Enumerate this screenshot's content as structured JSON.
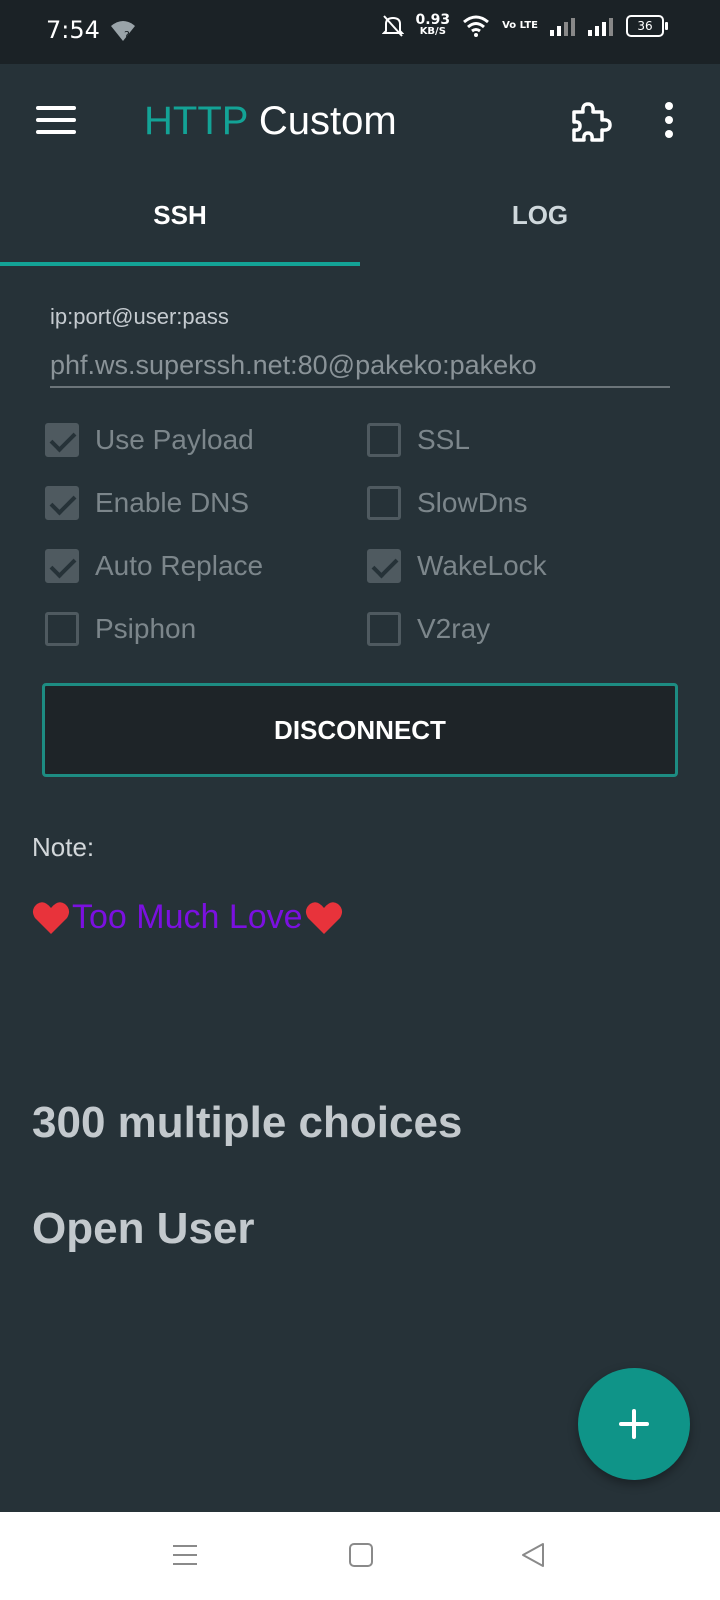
{
  "status_bar": {
    "time": "7:54",
    "speed_value": "0.93",
    "speed_unit": "KB/S",
    "volte": "Vo LTE",
    "battery": "36"
  },
  "app": {
    "title_accent": "HTTP",
    "title_rest": " Custom",
    "accent_color": "#13a396",
    "tabs": [
      {
        "label": "SSH",
        "active": true
      },
      {
        "label": "LOG",
        "active": false
      }
    ]
  },
  "form": {
    "host_label": "ip:port@user:pass",
    "host_value": "phf.ws.superssh.net:80@pakeko:pakeko"
  },
  "options": [
    {
      "label": "Use Payload",
      "checked": true
    },
    {
      "label": "SSL",
      "checked": false
    },
    {
      "label": "Enable DNS",
      "checked": true
    },
    {
      "label": "SlowDns",
      "checked": false
    },
    {
      "label": "Auto Replace",
      "checked": true
    },
    {
      "label": "WakeLock",
      "checked": true
    },
    {
      "label": "Psiphon",
      "checked": false
    },
    {
      "label": "V2ray",
      "checked": false
    }
  ],
  "actions": {
    "disconnect_label": "DISCONNECT"
  },
  "note": {
    "label": "Note:",
    "text": "Too Much Love",
    "line1": "300 multiple choices",
    "line2": "Open User"
  },
  "icons": {
    "fab": "plus-icon",
    "menu": "hamburger-icon",
    "plugin": "puzzle-icon",
    "more": "more-vert-icon"
  }
}
